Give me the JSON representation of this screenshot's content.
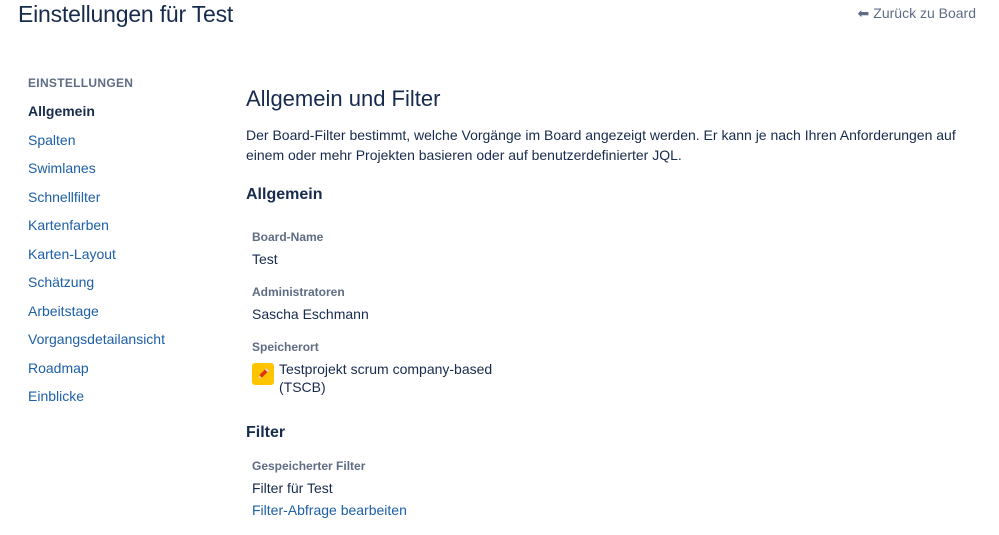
{
  "header": {
    "title": "Einstellungen für Test",
    "back_label": "Zurück zu Board"
  },
  "sidebar": {
    "heading": "EINSTELLUNGEN",
    "items": [
      {
        "label": "Allgemein",
        "active": true
      },
      {
        "label": "Spalten"
      },
      {
        "label": "Swimlanes"
      },
      {
        "label": "Schnellfilter"
      },
      {
        "label": "Kartenfarben"
      },
      {
        "label": "Karten-Layout"
      },
      {
        "label": "Schätzung"
      },
      {
        "label": "Arbeitstage"
      },
      {
        "label": "Vorgangsdetailansicht"
      },
      {
        "label": "Roadmap"
      },
      {
        "label": "Einblicke"
      }
    ]
  },
  "main": {
    "title": "Allgemein und Filter",
    "description": "Der Board-Filter bestimmt, welche Vorgänge im Board angezeigt werden. Er kann je nach Ihren Anforderungen auf einem oder mehr Projekten basieren oder auf benutzerdefinierter JQL.",
    "general": {
      "title": "Allgemein",
      "board_name_label": "Board-Name",
      "board_name_value": "Test",
      "admins_label": "Administratoren",
      "admins_value": "Sascha Eschmann",
      "location_label": "Speicherort",
      "location_line1": "Testprojekt scrum company-based",
      "location_line2": "(TSCB)"
    },
    "filter": {
      "title": "Filter",
      "saved_filter_label": "Gespeicherter Filter",
      "saved_filter_value": "Filter für Test",
      "edit_query_label": "Filter-Abfrage bearbeiten"
    }
  },
  "colors": {
    "text": "#172b4d",
    "muted": "#5e6c84",
    "link": "#1d5fa8",
    "project_avatar": "#ffc400"
  },
  "icons": {
    "back": "arrow-back-icon",
    "project": "pencil-icon"
  }
}
